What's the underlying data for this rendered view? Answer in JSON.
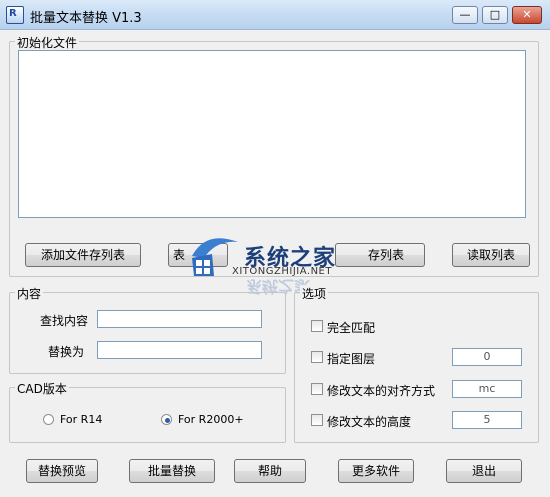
{
  "window": {
    "title": "批量文本替换 V1.3",
    "icon_label": "R",
    "minimize_glyph": "—",
    "maximize_glyph": "□",
    "close_glyph": "✕"
  },
  "init_group": {
    "label": "初始化文件",
    "buttons": [
      "添加文件存列表",
      "表",
      "存列表",
      "读取列表"
    ]
  },
  "content_group": {
    "label": "内容",
    "find_label": "查找内容",
    "find_value": "",
    "replace_label": "替换为",
    "replace_value": ""
  },
  "cad_group": {
    "label": "CAD版本",
    "options": [
      "For R14",
      "For R2000+"
    ],
    "selected": "For R2000+"
  },
  "options_group": {
    "label": "选项",
    "items": [
      {
        "label": "完全匹配",
        "checked": false,
        "value": null
      },
      {
        "label": "指定图层",
        "checked": false,
        "value": "0"
      },
      {
        "label": "修改文本的对齐方式",
        "checked": false,
        "value": "mc"
      },
      {
        "label": "修改文本的高度",
        "checked": false,
        "value": "5"
      }
    ]
  },
  "bottom_buttons": [
    "替换预览",
    "批量替换",
    "帮助",
    "更多软件",
    "退出"
  ],
  "watermark": {
    "title": "系统之家",
    "url": "XITONGZHIJIA.NET"
  }
}
